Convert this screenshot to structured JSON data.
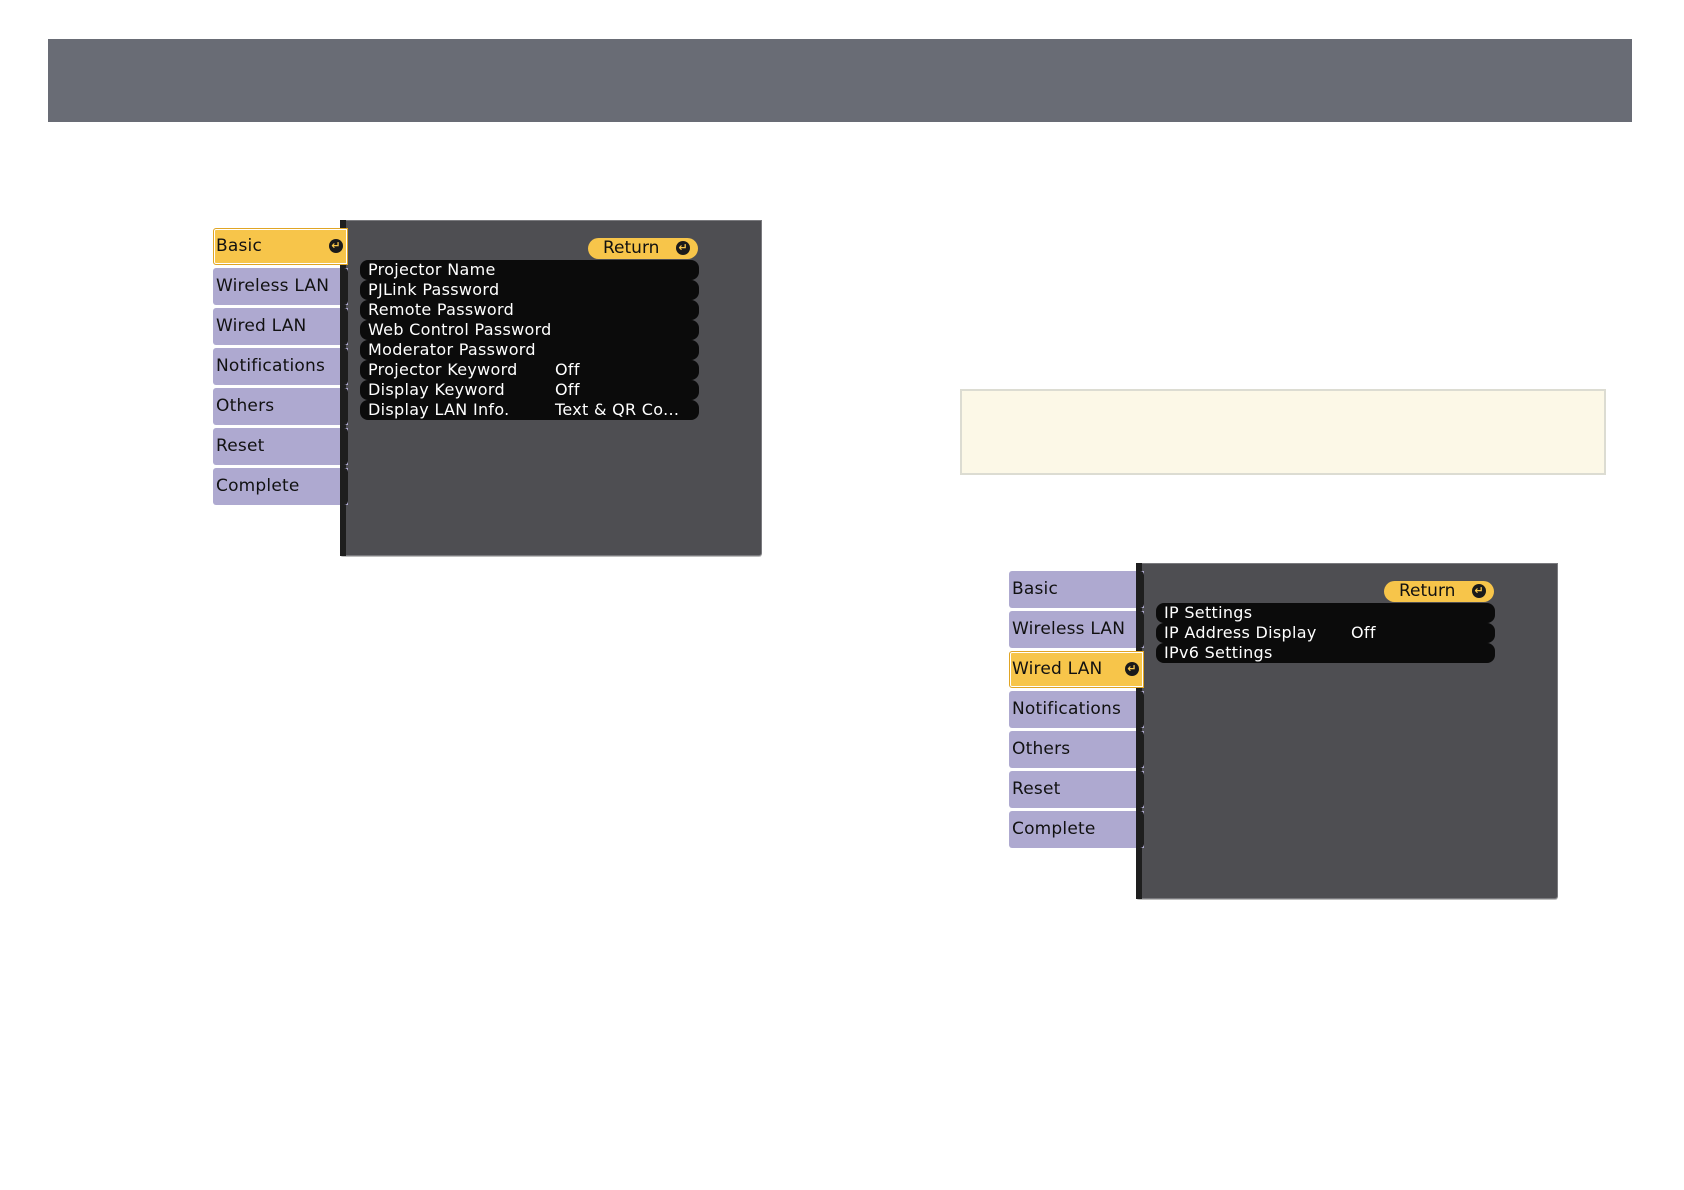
{
  "header": {
    "title": ""
  },
  "note": {
    "text": ""
  },
  "menu1": {
    "tabs": [
      {
        "label": "Basic",
        "active": true
      },
      {
        "label": "Wireless LAN",
        "active": false
      },
      {
        "label": "Wired LAN",
        "active": false
      },
      {
        "label": "Notifications",
        "active": false
      },
      {
        "label": "Others",
        "active": false
      },
      {
        "label": "Reset",
        "active": false
      },
      {
        "label": "Complete",
        "active": false
      }
    ],
    "return_label": "Return",
    "rows": [
      {
        "label": "Projector Name",
        "value": ""
      },
      {
        "label": "PJLink Password",
        "value": ""
      },
      {
        "label": "Remote Password",
        "value": ""
      },
      {
        "label": "Web Control Password",
        "value": ""
      },
      {
        "label": "Moderator Password",
        "value": ""
      },
      {
        "label": "Projector Keyword",
        "value": "Off"
      },
      {
        "label": "Display Keyword",
        "value": "Off"
      },
      {
        "label": "Display LAN Info.",
        "value": "Text & QR Co..."
      }
    ]
  },
  "menu2": {
    "tabs": [
      {
        "label": "Basic",
        "active": false
      },
      {
        "label": "Wireless LAN",
        "active": false
      },
      {
        "label": "Wired LAN",
        "active": true
      },
      {
        "label": "Notifications",
        "active": false
      },
      {
        "label": "Others",
        "active": false
      },
      {
        "label": "Reset",
        "active": false
      },
      {
        "label": "Complete",
        "active": false
      }
    ],
    "return_label": "Return",
    "rows": [
      {
        "label": "IP Settings",
        "value": ""
      },
      {
        "label": "IP Address Display",
        "value": "Off"
      },
      {
        "label": "IPv6 Settings",
        "value": ""
      }
    ]
  },
  "colors": {
    "header_bar": "#696c75",
    "menu_background": "#4e4e52",
    "tab_inactive": "#aea9d0",
    "tab_active": "#f7c54a",
    "row_background": "#0b0b0b",
    "note_background": "#fcf8e7"
  },
  "icons": {
    "enter": "enter-icon"
  }
}
